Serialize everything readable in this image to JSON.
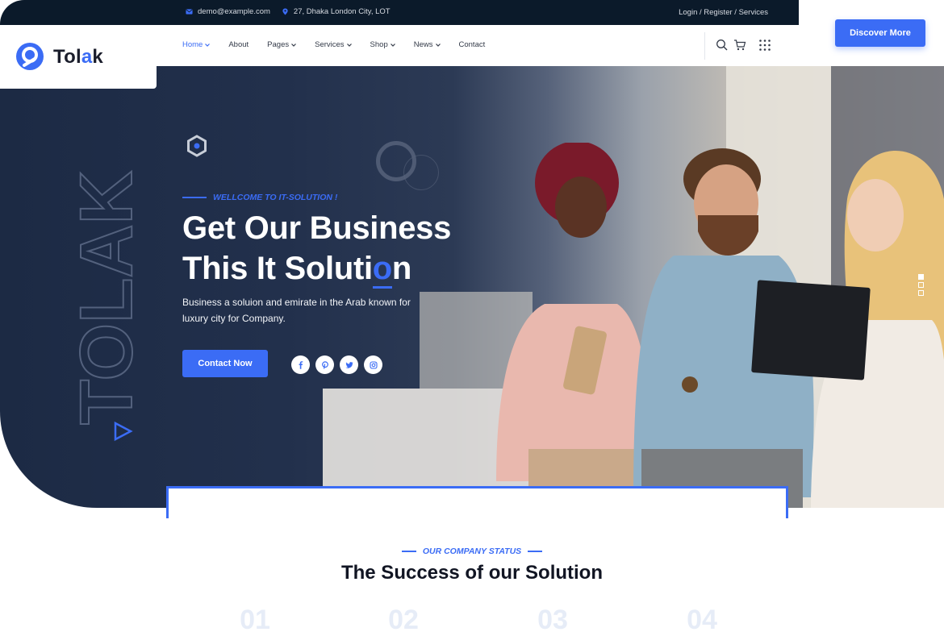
{
  "topbar": {
    "email": "demo@example.com",
    "address": "27, Dhaka London City, LOT",
    "auth_links": "Login / Register / Services"
  },
  "header": {
    "brand": {
      "part1": "Tol",
      "part2": "a",
      "part3": "k"
    },
    "discover_label": "Discover More",
    "menu": [
      {
        "label": "Home",
        "dropdown": true
      },
      {
        "label": "About",
        "dropdown": false
      },
      {
        "label": "Pages",
        "dropdown": true
      },
      {
        "label": "Services",
        "dropdown": true
      },
      {
        "label": "Shop",
        "dropdown": true
      },
      {
        "label": "News",
        "dropdown": true
      },
      {
        "label": "Contact",
        "dropdown": false
      }
    ],
    "icons": [
      "search-icon",
      "cart-icon",
      "grid-menu-icon"
    ]
  },
  "hero": {
    "vertical_word": "TOLAK",
    "welcome": "WELLCOME TO IT-SOLUTION !",
    "title_line1": "Get Our Business",
    "title_line2_a": "This It Soluti",
    "title_line2_o": "o",
    "title_line2_b": "n",
    "subtitle": "Business a soluion and emirate in the Arab known for luxury city for Company.",
    "cta_label": "Contact Now",
    "socials": [
      "facebook-icon",
      "pinterest-icon",
      "twitter-icon",
      "instagram-icon"
    ],
    "slider_active_index": 0,
    "slider_count": 3
  },
  "status_section": {
    "label": "OUR COMPANY STATUS",
    "title": "The Success of our Solution",
    "numbers": [
      "01",
      "02",
      "03",
      "04"
    ]
  },
  "colors": {
    "accent": "#3b6cf5",
    "topbar_bg": "#0b1a2a",
    "hero_dark": "#1c2a44"
  }
}
